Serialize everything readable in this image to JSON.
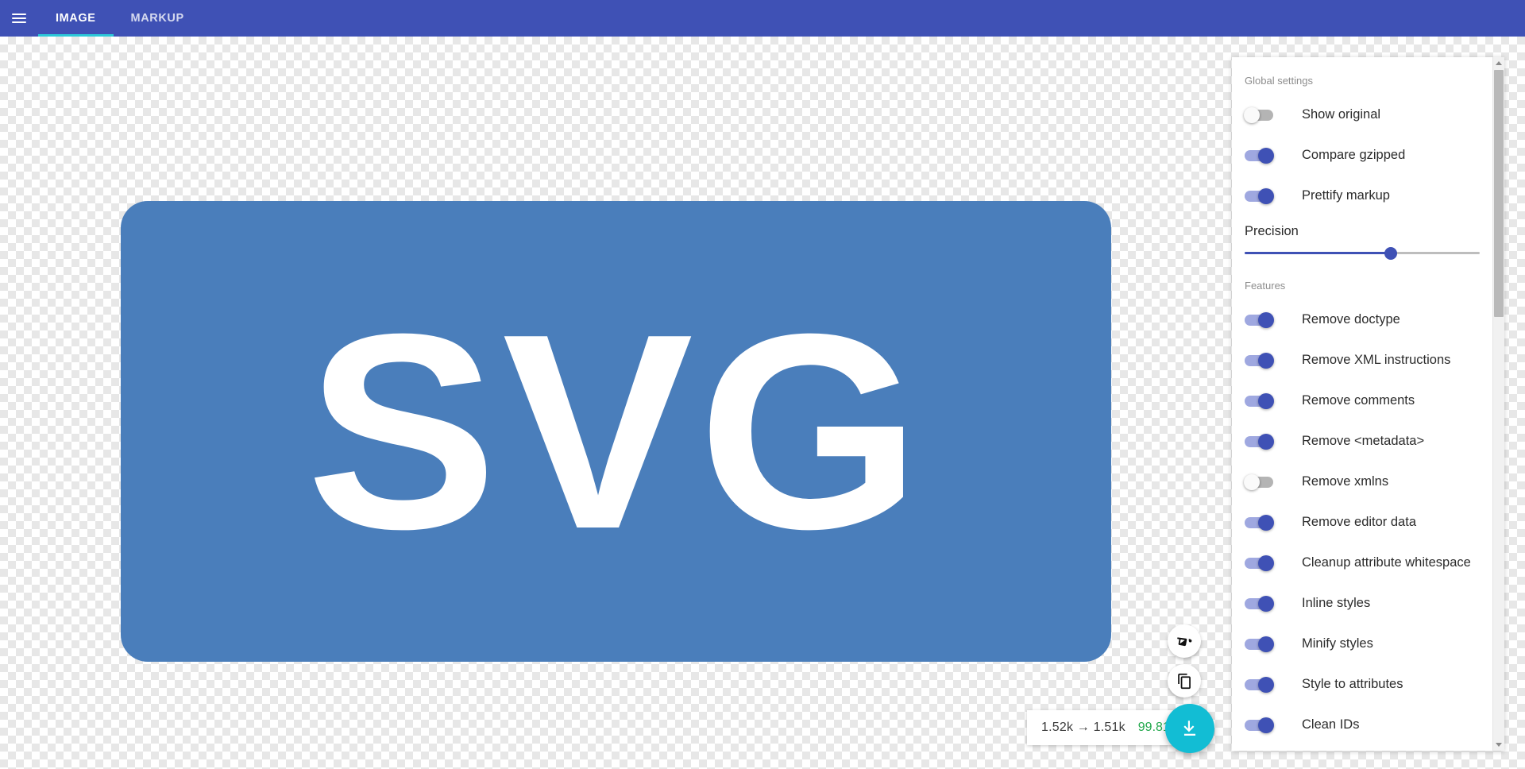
{
  "topbar": {
    "menu_icon": "hamburger-menu-icon",
    "tabs": [
      {
        "label": "IMAGE",
        "active": true
      },
      {
        "label": "MARKUP",
        "active": false
      }
    ],
    "background_color": "#3f51b5",
    "active_indicator_color": "#2cc8d8"
  },
  "preview": {
    "logo_text": "SVG",
    "logo_background_color": "#4a7ebb",
    "logo_text_color": "#ffffff"
  },
  "floating_actions": {
    "background_toggle_icon": "paint-bucket-icon",
    "copy_icon": "copy-icon",
    "download_icon": "download-icon",
    "download_color": "#12bdd4"
  },
  "size_badge": {
    "compare": "1.52k → 1.51k",
    "percent": "99.81%",
    "percent_color": "#22a84c"
  },
  "settings": {
    "global_heading": "Global settings",
    "global_options": [
      {
        "label": "Show original",
        "on": false
      },
      {
        "label": "Compare gzipped",
        "on": true
      },
      {
        "label": "Prettify markup",
        "on": true
      }
    ],
    "precision": {
      "label": "Precision",
      "value_percent": 62
    },
    "features_heading": "Features",
    "feature_options": [
      {
        "label": "Remove doctype",
        "on": true
      },
      {
        "label": "Remove XML instructions",
        "on": true
      },
      {
        "label": "Remove comments",
        "on": true
      },
      {
        "label": "Remove <metadata>",
        "on": true
      },
      {
        "label": "Remove xmlns",
        "on": false
      },
      {
        "label": "Remove editor data",
        "on": true
      },
      {
        "label": "Cleanup attribute whitespace",
        "on": true
      },
      {
        "label": "Inline styles",
        "on": true
      },
      {
        "label": "Minify styles",
        "on": true
      },
      {
        "label": "Style to attributes",
        "on": true
      },
      {
        "label": "Clean IDs",
        "on": true
      }
    ],
    "toggle_on_color": "#3f51b5",
    "toggle_off_color": "#b4b4b4"
  }
}
